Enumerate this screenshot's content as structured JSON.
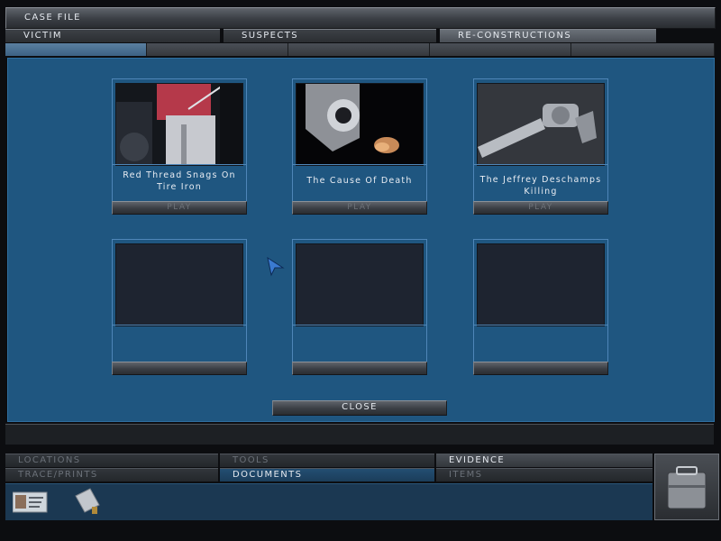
{
  "title": "Case File",
  "tabs": [
    {
      "label": "Victim"
    },
    {
      "label": "Suspects"
    },
    {
      "label": "Re-constructions"
    }
  ],
  "cards": [
    {
      "caption": "Red Thread Snags On Tire Iron",
      "play_label": "Play"
    },
    {
      "caption": "The Cause Of Death",
      "play_label": "Play"
    },
    {
      "caption": "The Jeffrey Deschamps Killing",
      "play_label": "Play"
    },
    {
      "caption": "",
      "play_label": ""
    },
    {
      "caption": "",
      "play_label": ""
    },
    {
      "caption": "",
      "play_label": ""
    }
  ],
  "close_label": "Close",
  "bottom_tabs": {
    "row1": [
      "Locations",
      "Tools",
      "Evidence"
    ],
    "row2": [
      "Trace/Prints",
      "Documents",
      "Items"
    ]
  },
  "inventory": [
    {
      "icon": "id-card-icon"
    },
    {
      "icon": "paper-evidence-icon"
    }
  ],
  "colors": {
    "panel": "#1f5680",
    "border": "#4f86b8"
  }
}
